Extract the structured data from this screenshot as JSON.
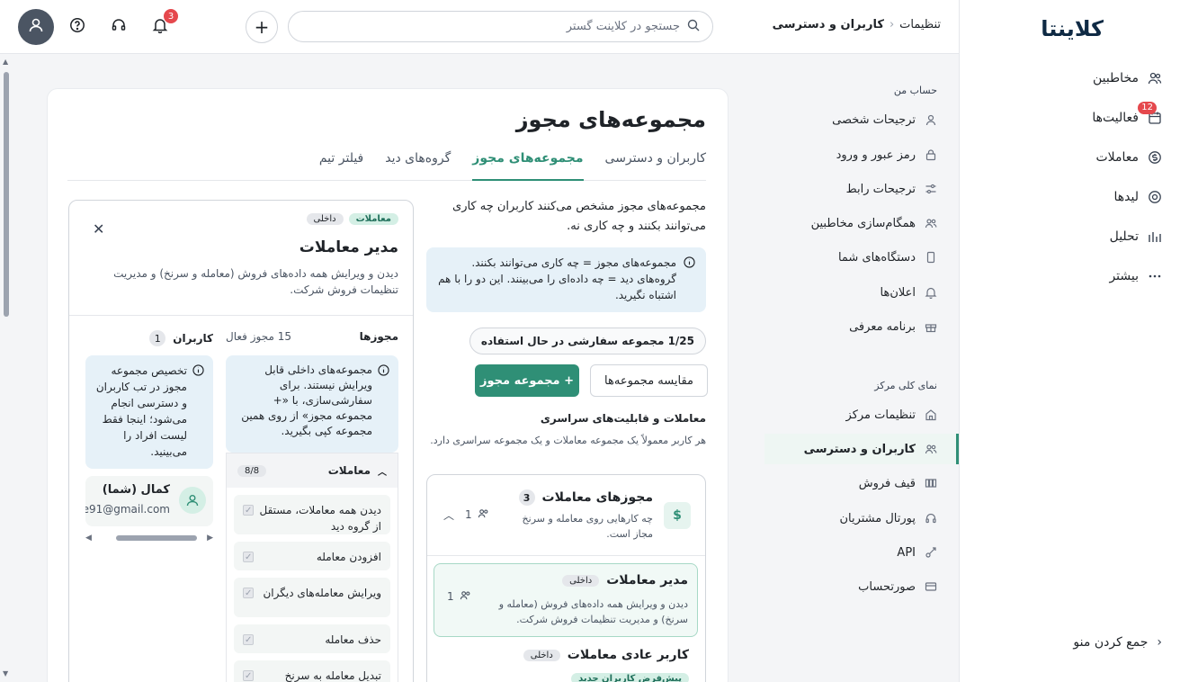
{
  "brand": {
    "logo": "کلاینتا"
  },
  "main_nav": {
    "items": [
      {
        "label": "مخاطبین",
        "icon": "users-icon"
      },
      {
        "label": "فعالیت‌ها",
        "icon": "calendar-icon",
        "badge": "12"
      },
      {
        "label": "معاملات",
        "icon": "coin-icon"
      },
      {
        "label": "لیدها",
        "icon": "target-icon"
      },
      {
        "label": "تحلیل",
        "icon": "chart-icon"
      },
      {
        "label": "بیشتر",
        "icon": "more-icon"
      }
    ],
    "collapse_label": "جمع کردن منو"
  },
  "topbar": {
    "breadcrumb_root": "تنظیمات",
    "breadcrumb_current": "کاربران و دسترسی",
    "search_placeholder": "جستجو در کلاینت گستر",
    "notifications_count": "3"
  },
  "settings_nav": {
    "section_account": "حساب من",
    "account_items": [
      {
        "label": "ترجیحات شخصی",
        "icon": "user-icon"
      },
      {
        "label": "رمز عبور و ورود",
        "icon": "lock-icon"
      },
      {
        "label": "ترجیحات رابط",
        "icon": "sliders-icon"
      },
      {
        "label": "همگام‌سازی مخاطبین",
        "icon": "sync-users-icon"
      },
      {
        "label": "دستگاه‌های شما",
        "icon": "phone-icon"
      },
      {
        "label": "اعلان‌ها",
        "icon": "bell-icon"
      },
      {
        "label": "برنامه معرفی",
        "icon": "gift-icon"
      }
    ],
    "section_center": "نمای کلی مرکز",
    "center_items": [
      {
        "label": "تنظیمات مرکز",
        "icon": "building-icon"
      },
      {
        "label": "کاربران و دسترسی",
        "icon": "users-icon",
        "active": true
      },
      {
        "label": "قیف فروش",
        "icon": "pipeline-icon"
      },
      {
        "label": "پورتال مشتریان",
        "icon": "headset-icon"
      },
      {
        "label": "API",
        "icon": "api-icon"
      },
      {
        "label": "صورتحساب",
        "icon": "card-icon"
      }
    ]
  },
  "page": {
    "title": "مجموعه‌های مجوز",
    "tabs": [
      "کاربران و دسترسی",
      "مجموعه‌های مجوز",
      "گروه‌های دید",
      "فیلتر تیم"
    ],
    "active_tab": 1,
    "intro": "مجموعه‌های مجوز مشخص می‌کنند کاربران چه کاری می‌توانند بکنند و چه کاری نه.",
    "info": "مجموعه‌های مجوز = چه کاری می‌توانند بکنند. گروه‌های دید = چه داده‌ای را می‌بینند. این دو را با هم اشتباه نگیرید.",
    "usage": "1/25 مجموعه سفارشی در حال استفاده",
    "btn_new": "+ مجموعه مجوز",
    "btn_compare": "مقایسه مجموعه‌ها",
    "section_title": "معاملات و قابلیت‌های سراسری",
    "section_desc": "هر کاربر معمولاً یک مجموعه معاملات و یک مجموعه سراسری دارد."
  },
  "group": {
    "title": "مجوزهای معاملات",
    "count": "3",
    "desc": "چه کارهایی روی معامله و سرنخ مجاز است.",
    "users": "1",
    "icon": "dollar-icon",
    "roles": [
      {
        "title": "مدیر معاملات",
        "tag": "داخلی",
        "desc": "دیدن و ویرایش همه داده‌های فروش (معامله و سرنخ) و مدیریت تنظیمات فروش شرکت.",
        "users": "1"
      },
      {
        "title": "کاربر عادی معاملات",
        "tag": "داخلی",
        "default_tag": "پیش‌فرض کاربران جدید"
      }
    ]
  },
  "panel": {
    "tag_category": "معاملات",
    "tag_type": "داخلی",
    "title": "مدیر معاملات",
    "desc": "دیدن و ویرایش همه داده‌های فروش (معامله و سرنخ) و مدیریت تنظیمات فروش شرکت.",
    "perms_label": "مجوزها",
    "perms_active": "15 مجوز فعال",
    "perms_info": "مجموعه‌های داخلی قابل ویرایش نیستند. برای سفارشی‌سازی، با «+ مجموعه مجوز» از روی همین مجموعه کپی بگیرید.",
    "category": "معاملات",
    "category_count": "8/8",
    "perm_items": [
      "دیدن همه معاملات، مستقل از گروه دید",
      "افزودن معامله",
      "ویرایش معامله‌های دیگران",
      "حذف معامله",
      "تبدیل معامله به سرنخ"
    ],
    "users_label": "کاربران",
    "users_count": "1",
    "users_info": "تخصیص مجموعه مجوز در تب کاربران و دسترسی انجام می‌شود؛ اینجا فقط لیست افراد را می‌بینید.",
    "user_name": "کمال (شما)",
    "user_email": "e91@gmail.com"
  }
}
